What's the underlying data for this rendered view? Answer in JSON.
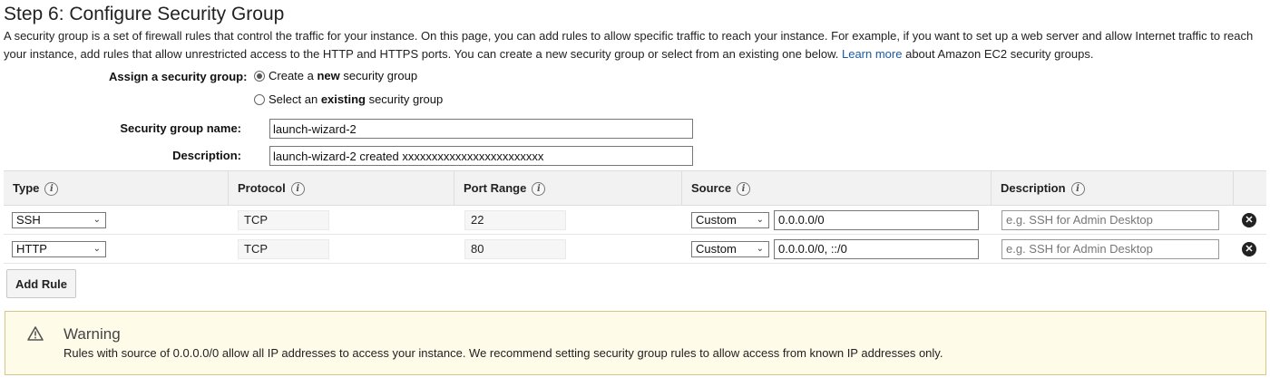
{
  "page": {
    "title": "Step 6: Configure Security Group",
    "intro_text": "A security group is a set of firewall rules that control the traffic for your instance. On this page, you can add rules to allow specific traffic to reach your instance. For example, if you want to set up a web server and allow Internet traffic to reach your instance, add rules that allow unrestricted access to the HTTP and HTTPS ports. You can create a new security group or select from an existing one below.",
    "learn_more_link": "Learn more",
    "learn_more_suffix": "about Amazon EC2 security groups."
  },
  "assign": {
    "label": "Assign a security group:",
    "options": [
      {
        "prefix": "Create a ",
        "bold": "new",
        "suffix": " security group",
        "selected": true
      },
      {
        "prefix": "Select an ",
        "bold": "existing",
        "suffix": " security group",
        "selected": false
      }
    ]
  },
  "form": {
    "name_label": "Security group name:",
    "name_value": "launch-wizard-2",
    "description_label": "Description:",
    "description_value": "launch-wizard-2 created xxxxxxxxxxxxxxxxxxxxxxxx"
  },
  "table": {
    "columns": [
      "Type",
      "Protocol",
      "Port Range",
      "Source",
      "Description"
    ],
    "info_icon": "info-icon",
    "rows": [
      {
        "type": "SSH",
        "protocol": "TCP",
        "port_range": "22",
        "source_type": "Custom",
        "source_value": "0.0.0.0/0",
        "description_placeholder": "e.g. SSH for Admin Desktop"
      },
      {
        "type": "HTTP",
        "protocol": "TCP",
        "port_range": "80",
        "source_type": "Custom",
        "source_value": "0.0.0.0/0, ::/0",
        "description_placeholder": "e.g. SSH for Admin Desktop"
      }
    ],
    "remove_icon": "close-circle-icon"
  },
  "add_rule_label": "Add Rule",
  "warning": {
    "icon": "warning-triangle-icon",
    "title": "Warning",
    "text": "Rules with source of 0.0.0.0/0 allow all IP addresses to access your instance. We recommend setting security group rules to allow access from known IP addresses only."
  }
}
